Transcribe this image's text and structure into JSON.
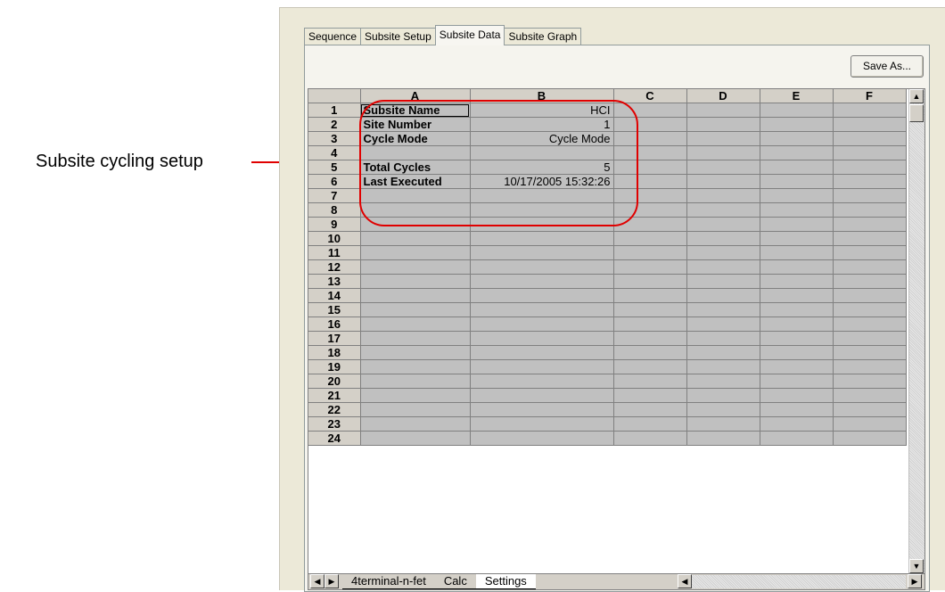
{
  "callout": {
    "text": "Subsite cycling setup"
  },
  "tabs": [
    {
      "label": "Sequence",
      "active": false
    },
    {
      "label": "Subsite Setup",
      "active": false
    },
    {
      "label": "Subsite Data",
      "active": true
    },
    {
      "label": "Subsite Graph",
      "active": false
    }
  ],
  "toolbar": {
    "save_label": "Save As..."
  },
  "grid": {
    "columns": [
      "A",
      "B",
      "C",
      "D",
      "E",
      "F"
    ],
    "rows": [
      {
        "num": "1",
        "a": "Subsite Name",
        "b": "HCI"
      },
      {
        "num": "2",
        "a": "Site Number",
        "b": "1"
      },
      {
        "num": "3",
        "a": "Cycle Mode",
        "b": "Cycle Mode"
      },
      {
        "num": "4",
        "a": "",
        "b": ""
      },
      {
        "num": "5",
        "a": "Total Cycles",
        "b": "5"
      },
      {
        "num": "6",
        "a": "Last Executed",
        "b": "10/17/2005 15:32:26"
      },
      {
        "num": "7"
      },
      {
        "num": "8"
      },
      {
        "num": "9"
      },
      {
        "num": "10"
      },
      {
        "num": "11"
      },
      {
        "num": "12"
      },
      {
        "num": "13"
      },
      {
        "num": "14"
      },
      {
        "num": "15"
      },
      {
        "num": "16"
      },
      {
        "num": "17"
      },
      {
        "num": "18"
      },
      {
        "num": "19"
      },
      {
        "num": "20"
      },
      {
        "num": "21"
      },
      {
        "num": "22"
      },
      {
        "num": "23"
      },
      {
        "num": "24"
      }
    ]
  },
  "sheets": [
    {
      "label": "4terminal-n-fet",
      "active": false
    },
    {
      "label": "Calc",
      "active": false
    },
    {
      "label": "Settings",
      "active": true
    }
  ],
  "colors": {
    "highlight": "#e00000",
    "cell": "#c0c0c0",
    "header": "#d4d0c8"
  }
}
